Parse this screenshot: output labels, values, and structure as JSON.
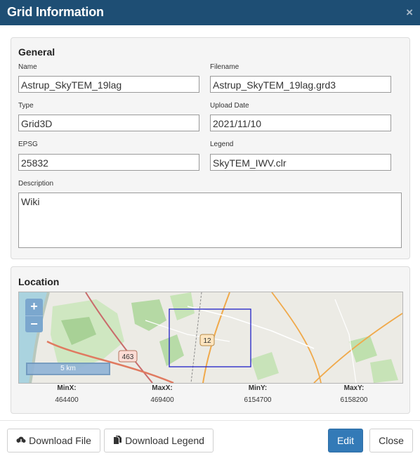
{
  "dialog": {
    "title": "Grid Information",
    "close_icon": "×"
  },
  "general": {
    "heading": "General",
    "name_label": "Name",
    "name_value": "Astrup_SkyTEM_19lag",
    "filename_label": "Filename",
    "filename_value": "Astrup_SkyTEM_19lag.grd3",
    "type_label": "Type",
    "type_value": "Grid3D",
    "upload_label": "Upload Date",
    "upload_value": "2021/11/10",
    "epsg_label": "EPSG",
    "epsg_value": "25832",
    "legend_label": "Legend",
    "legend_value": "SkyTEM_IWV.clr",
    "description_label": "Description",
    "description_value": "Wiki"
  },
  "location": {
    "heading": "Location",
    "zoom_in": "+",
    "zoom_out": "−",
    "scale_label": "5 km",
    "road_labels": [
      "463",
      "12"
    ],
    "coords": [
      {
        "key": "MinX:",
        "value": "464400"
      },
      {
        "key": "MaxX:",
        "value": "469400"
      },
      {
        "key": "MinY:",
        "value": "6154700"
      },
      {
        "key": "MaxY:",
        "value": "6158200"
      }
    ]
  },
  "footer": {
    "download_file": "Download File",
    "download_legend": "Download Legend",
    "edit": "Edit",
    "close": "Close"
  },
  "colors": {
    "header": "#1e4e74",
    "primary": "#337ab7",
    "bbox": "#2020c8"
  },
  "icons": {
    "download": "cloud-download-icon",
    "legend": "copy-file-icon"
  }
}
